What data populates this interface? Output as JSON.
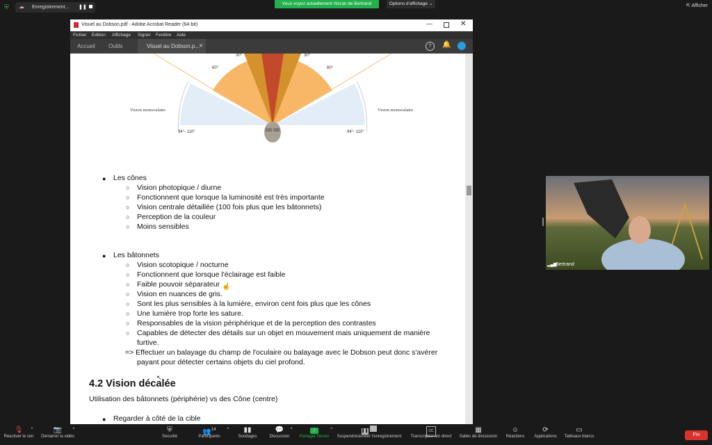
{
  "zoom_top": {
    "recording_label": "Enregistrement...",
    "share_banner": "Vous voyez actuellement l'écran de Bertrand",
    "view_options": "Options d'affichage",
    "show_label": "Afficher"
  },
  "acrobat": {
    "title": "Visuel au Dobson.pdf - Adobe Acrobat Reader (64-bit)",
    "menu": [
      "Fichier",
      "Edition",
      "Affichage",
      "Signer",
      "Fenêtre",
      "Aide"
    ],
    "tabs": {
      "home": "Accueil",
      "tools": "Outils",
      "doc": "Visuel au Dobson.p..."
    },
    "diagram": {
      "angle_30_left": "30°",
      "angle_30_right": "30°",
      "angle_60_left": "60°",
      "angle_60_right": "60°",
      "mono_left": "Vision monoculaire",
      "mono_right": "Vision monoculaire",
      "range_left": "94°- 110°",
      "range_right": "94°- 110°",
      "eyes": "OG OD"
    },
    "cones": {
      "title": "Les cônes",
      "items": [
        "Vision photopique / diurne",
        "Fonctionnent que lorsque la luminosité est très importante",
        "Vision centrale détaillée (100 fois plus que les bâtonnets)",
        "Perception de la couleur",
        "Moins sensibles"
      ]
    },
    "rods": {
      "title": "Les bâtonnets",
      "items": [
        "Vision scotopique / nocturne",
        "Fonctionnent que lorsque l'éclairage est faible",
        "Faible pouvoir séparateur",
        "Vision en nuances de gris.",
        "Sont les plus sensibles à la lumière, environ cent fois plus que les cônes",
        "Une lumière trop forte les sature.",
        "Responsables de la vision périphérique et de la perception des contrastes",
        "Capables de détecter des détails sur un objet en mouvement mais uniquement de manière"
      ],
      "item8_cont": "furtive.",
      "conclusion_1": "=> Effectuer un balayage du champ de l'oculaire ou balayage avec le Dobson peut donc s'avérer",
      "conclusion_2": "payant pour détecter certains objets du ciel profond."
    },
    "section_title": "4.2 Vision décalée",
    "section_sub": "Utilisation des bâtonnets (périphérie) vs des Cône (centre)",
    "last_bullet": "Regarder à côté de la cible"
  },
  "video": {
    "name": "Bertrand"
  },
  "toolbar": {
    "audio": "Réactiver le son",
    "video": "Démarrer la vidéo",
    "security": "Sécurité",
    "participants": "Participants",
    "participants_count": "14",
    "polls": "Sondages",
    "chat": "Discussion",
    "share": "Partager l'écran",
    "record": "Suspendre/arrêter l'enregistrement",
    "cc": "Transcription en direct",
    "breakout": "Salles de discussion",
    "reactions": "Réactions",
    "apps": "Applications",
    "whiteboards": "Tableaux blancs",
    "end": "Fin"
  }
}
